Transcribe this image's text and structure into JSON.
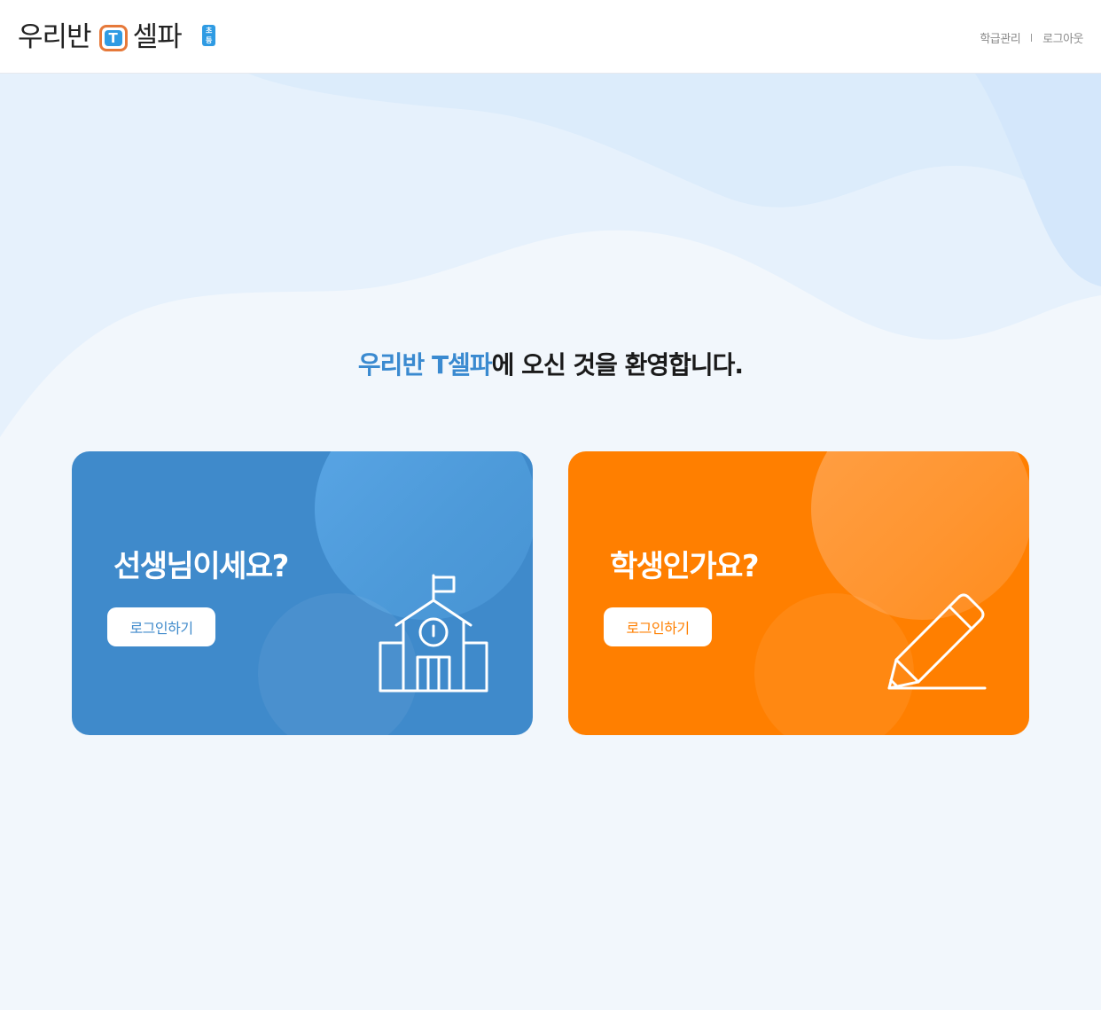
{
  "header": {
    "logo": {
      "prefix": "우리반",
      "t_letter": "T",
      "suffix": "셀파",
      "badge": "초등"
    },
    "nav": {
      "class_management": "학급관리",
      "logout": "로그아웃"
    }
  },
  "welcome": {
    "highlight": "우리반 T셀파",
    "rest": "에 오신 것을 환영합니다."
  },
  "cards": {
    "teacher": {
      "title": "선생님이세요?",
      "button": "로그인하기",
      "icon": "school-icon",
      "color": "#3f8acb"
    },
    "student": {
      "title": "학생인가요?",
      "button": "로그인하기",
      "icon": "pencil-icon",
      "color": "#ff7f00"
    }
  },
  "colors": {
    "accent_blue": "#3a8ad0",
    "logo_blue": "#2f9be3",
    "logo_orange": "#e6793a",
    "background": "#f2f7fc"
  }
}
